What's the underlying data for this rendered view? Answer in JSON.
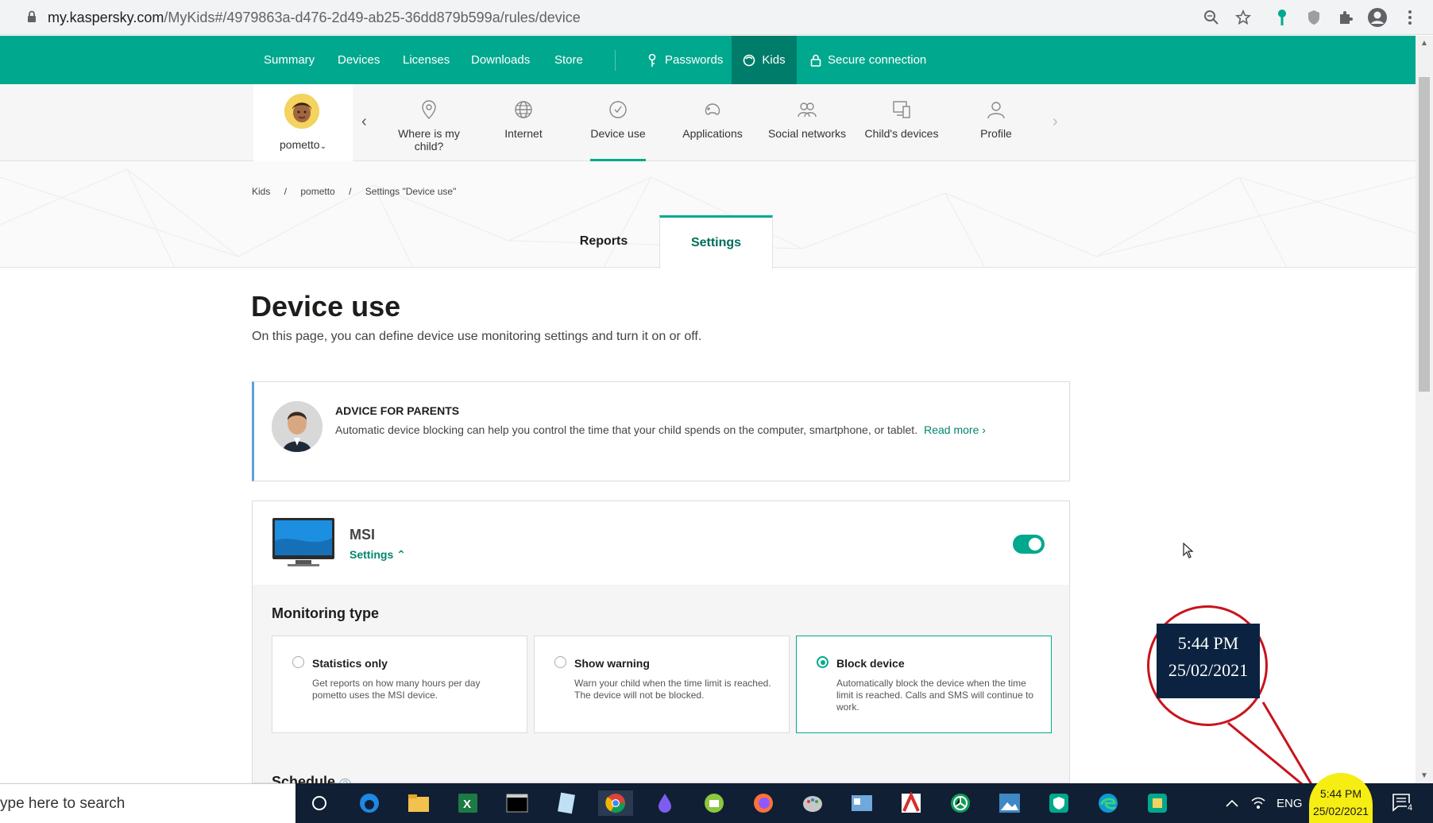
{
  "browser": {
    "url_host": "my.kaspersky.com",
    "url_path": "/MyKids#/4979863a-d476-2d49-ab25-36dd879b599a/rules/device"
  },
  "topnav": {
    "items": [
      "Summary",
      "Devices",
      "Licenses",
      "Downloads",
      "Store"
    ],
    "passwords": "Passwords",
    "kids": "Kids",
    "secure": "Secure connection"
  },
  "profile": {
    "name": "pometto"
  },
  "subnav": {
    "tabs": [
      "Where is my child?",
      "Internet",
      "Device use",
      "Applications",
      "Social networks",
      "Child's devices",
      "Profile"
    ],
    "active": "Device use"
  },
  "breadcrumb": [
    "Kids",
    "/",
    "pometto",
    "/",
    "Settings \"Device use\""
  ],
  "page_tabs": {
    "reports": "Reports",
    "settings": "Settings"
  },
  "page": {
    "title": "Device use",
    "subtitle": "On this page, you can define device use monitoring settings and turn it on or off."
  },
  "advice": {
    "heading": "ADVICE FOR PARENTS",
    "text": "Automatic device blocking can help you control the time that your child spends on the computer, smartphone, or tablet.",
    "link": "Read more ›"
  },
  "device": {
    "name": "MSI",
    "settings_label": "Settings ⌃",
    "enabled": true
  },
  "monitoring": {
    "title": "Monitoring type",
    "options": [
      {
        "label": "Statistics only",
        "desc": "Get reports on how many hours per day pometto uses the MSI device.",
        "selected": false
      },
      {
        "label": "Show warning",
        "desc": "Warn your child when the time limit is reached. The device will not be blocked.",
        "selected": false
      },
      {
        "label": "Block device",
        "desc": "Automatically block the device when the time limit is reached. Calls and SMS will continue to work.",
        "selected": true
      }
    ],
    "schedule": "Schedule"
  },
  "callout": {
    "time": "5:44 PM",
    "date": "25/02/2021"
  },
  "taskbar": {
    "search_placeholder": "ype here to search",
    "lang": "ENG",
    "time": "5:44 PM",
    "date": "25/02/2021",
    "notif_count": "4"
  },
  "colors": {
    "brand": "#00a88e",
    "brand_dark": "#007d6a",
    "link": "#00866f",
    "callout": "#c9131d",
    "highlight": "#f6ed13"
  }
}
